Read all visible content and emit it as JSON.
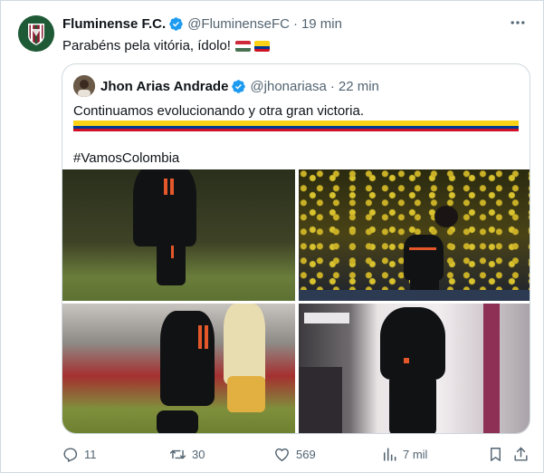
{
  "tweet": {
    "author_name": "Fluminense F.C.",
    "handle": "@FluminenseFC",
    "separator": "·",
    "time": "19 min",
    "text": "Parabéns pela vitória, ídolo!",
    "avatar_icon": "fluminense-crest-icon",
    "flags": [
      "hungary-flag-icon",
      "colombia-flag-icon"
    ]
  },
  "quote": {
    "author_name": "Jhon Arias Andrade",
    "handle": "@jhonariasa",
    "separator": "·",
    "time": "22 min",
    "text": "Continuamos evolucionando y otra gran victoria.",
    "hashtag": "#VamosColombia",
    "flag": "colombia-flag-icon",
    "photos": [
      "player-running-stadium-photo",
      "player-standing-crowd-photo",
      "player-tackle-photo",
      "player-tunnel-photo"
    ]
  },
  "actions": {
    "replies": "11",
    "reposts": "30",
    "likes": "569",
    "views": "7 mil"
  },
  "colors": {
    "verified": "#1d9bf0",
    "text_primary": "#0f1419",
    "text_muted": "#536471",
    "border": "#cfd9de",
    "colombia_yellow": "#fcd116",
    "colombia_blue": "#003893",
    "colombia_red": "#ce1126"
  }
}
